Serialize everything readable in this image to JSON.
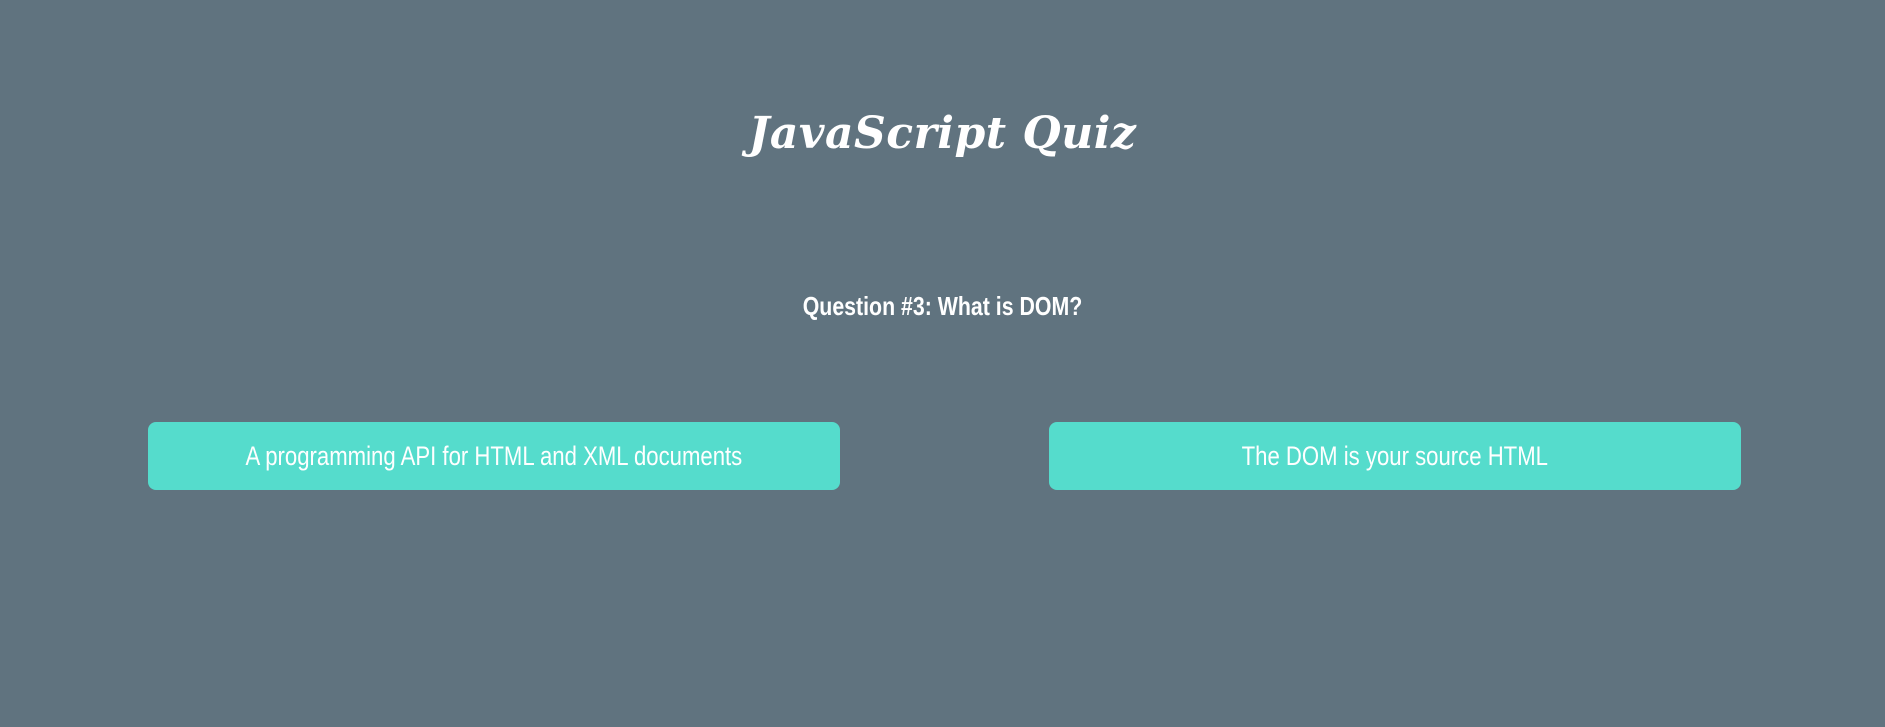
{
  "quiz": {
    "title": "JavaScript Quiz"
  },
  "question": {
    "text": "Question #3: What is DOM?"
  },
  "answers": [
    {
      "label": "A programming API for HTML and XML documents"
    },
    {
      "label": "The DOM is your source HTML"
    }
  ],
  "colors": {
    "background": "#60737f",
    "button": "#55dccc",
    "text": "#ffffff"
  }
}
